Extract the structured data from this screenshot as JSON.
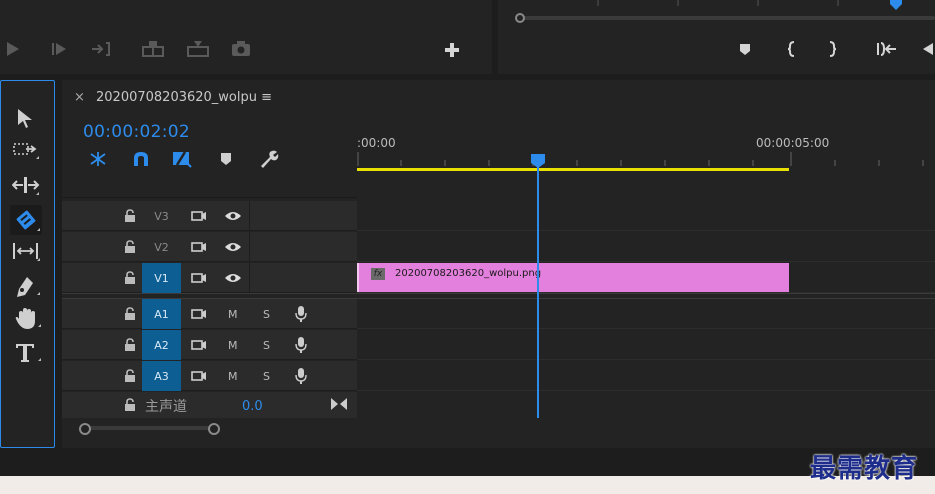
{
  "sequence": {
    "tab_name": "20200708203620_wolpu",
    "close_glyph": "×",
    "menu_glyph": "≡",
    "timecode": "00:00:02:02"
  },
  "ruler": {
    "start_label": ":00:00",
    "end_label": "00:00:05:00",
    "playhead_time": "00:00:02:02"
  },
  "tracks": {
    "video": [
      {
        "label": "V3",
        "targeted": false
      },
      {
        "label": "V2",
        "targeted": false
      },
      {
        "label": "V1",
        "targeted": true
      }
    ],
    "audio": [
      {
        "label": "A1",
        "mute": "M",
        "solo": "S",
        "targeted": true
      },
      {
        "label": "A2",
        "mute": "M",
        "solo": "S",
        "targeted": true
      },
      {
        "label": "A3",
        "mute": "M",
        "solo": "S",
        "targeted": true
      }
    ],
    "master": {
      "label": "主声道",
      "value": "0.0"
    }
  },
  "clip": {
    "fx_label": "fx",
    "name": "20200708203620_wolpu.png",
    "color": "#e37fdc"
  },
  "colors": {
    "accent": "#2d8ceb",
    "work_area": "#e8e000",
    "target_on": "#0d5e93",
    "clip": "#e37fdc"
  },
  "watermark": "最需教育",
  "tools": [
    "selection-tool",
    "track-select-tool",
    "ripple-edit-tool",
    "razor-tool",
    "slip-tool",
    "pen-tool",
    "hand-tool",
    "type-tool"
  ]
}
